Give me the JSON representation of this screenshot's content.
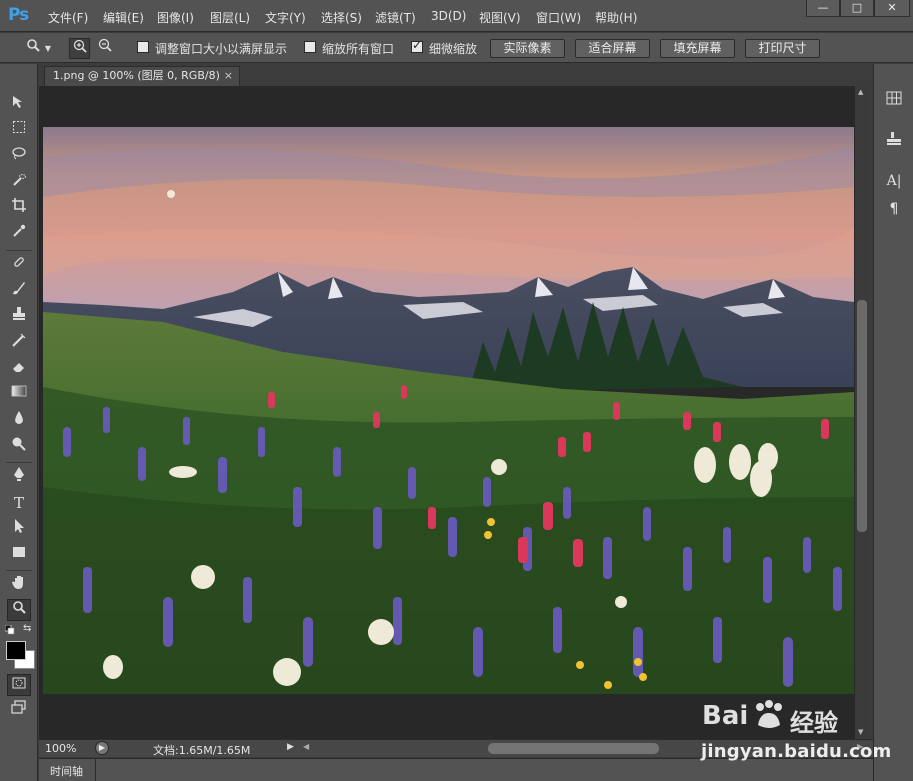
{
  "app": {
    "logo": "Ps"
  },
  "menu": [
    "文件(F)",
    "编辑(E)",
    "图像(I)",
    "图层(L)",
    "文字(Y)",
    "选择(S)",
    "滤镜(T)",
    "3D(D)",
    "视图(V)",
    "窗口(W)",
    "帮助(H)"
  ],
  "window_controls": {
    "minimize": "—",
    "maximize": "□",
    "close": "✕"
  },
  "options": {
    "resize_windows_label": "调整窗口大小以满屏显示",
    "zoom_all_label": "缩放所有窗口",
    "scrubby_zoom_label": "细微缩放",
    "resize_windows_checked": false,
    "zoom_all_checked": false,
    "scrubby_zoom_checked": true,
    "actual_pixels": "实际像素",
    "fit_screen": "适合屏幕",
    "fill_screen": "填充屏幕",
    "print_size": "打印尺寸"
  },
  "document": {
    "tab_title": "1.png @ 100% (图层 0, RGB/8)",
    "close_glyph": "×"
  },
  "status": {
    "zoom": "100%",
    "doc_size": "文档:1.65M/1.65M"
  },
  "timeline_label": "时间轴",
  "watermark": {
    "brand": "Bai",
    "brand2": "经验",
    "url": "jingyan.baidu.com"
  },
  "colors": {
    "accent": "#3fa2e6",
    "foreground": "#000000",
    "background": "#ffffff"
  }
}
